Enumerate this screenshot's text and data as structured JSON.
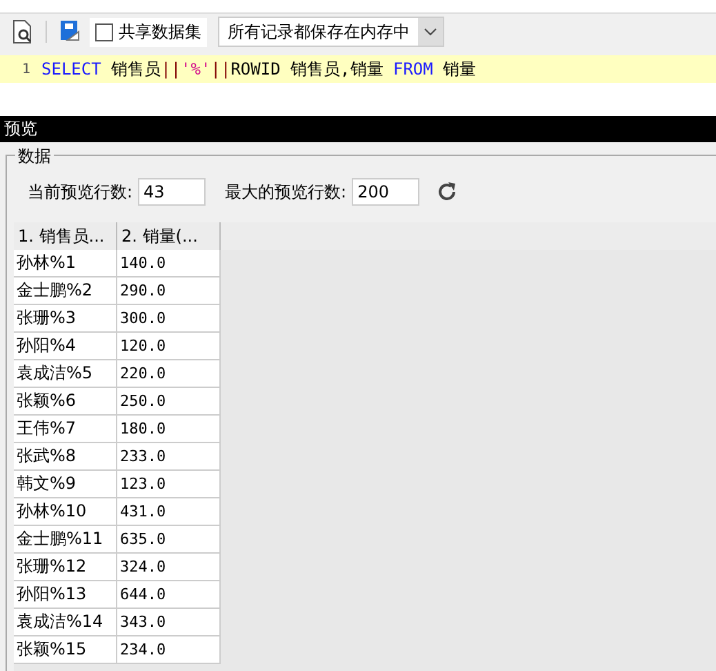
{
  "toolbar": {
    "share_checkbox": {
      "label": "共享数据集",
      "checked": false
    },
    "storage_select": {
      "value": "所有记录都保存在内存中"
    }
  },
  "editor": {
    "line_number": "1",
    "tokens": [
      {
        "kind": "keyword",
        "text": "SELECT"
      },
      {
        "kind": "plain",
        "text": " 销售员"
      },
      {
        "kind": "operator",
        "text": "||"
      },
      {
        "kind": "string",
        "text": "'%'"
      },
      {
        "kind": "operator",
        "text": "||"
      },
      {
        "kind": "plain",
        "text": "ROWID 销售员,销量 "
      },
      {
        "kind": "keyword",
        "text": "FROM"
      },
      {
        "kind": "plain",
        "text": " 销量"
      }
    ]
  },
  "preview": {
    "title": "预览",
    "group_title": "数据",
    "current_rows_label": "当前预览行数:",
    "current_rows": "43",
    "max_rows_label": "最大的预览行数:",
    "max_rows": "200",
    "table": {
      "columns": [
        "1. 销售员...",
        "2. 销量(..."
      ],
      "rows": [
        [
          "孙林%1",
          "140.0"
        ],
        [
          "金士鹏%2",
          "290.0"
        ],
        [
          "张珊%3",
          "300.0"
        ],
        [
          "孙阳%4",
          "120.0"
        ],
        [
          "袁成洁%5",
          "220.0"
        ],
        [
          "张颖%6",
          "250.0"
        ],
        [
          "王伟%7",
          "180.0"
        ],
        [
          "张武%8",
          "233.0"
        ],
        [
          "韩文%9",
          "123.0"
        ],
        [
          "孙林%10",
          "431.0"
        ],
        [
          "金士鹏%11",
          "635.0"
        ],
        [
          "张珊%12",
          "324.0"
        ],
        [
          "孙阳%13",
          "644.0"
        ],
        [
          "袁成洁%14",
          "343.0"
        ],
        [
          "张颖%15",
          "234.0"
        ]
      ]
    }
  }
}
